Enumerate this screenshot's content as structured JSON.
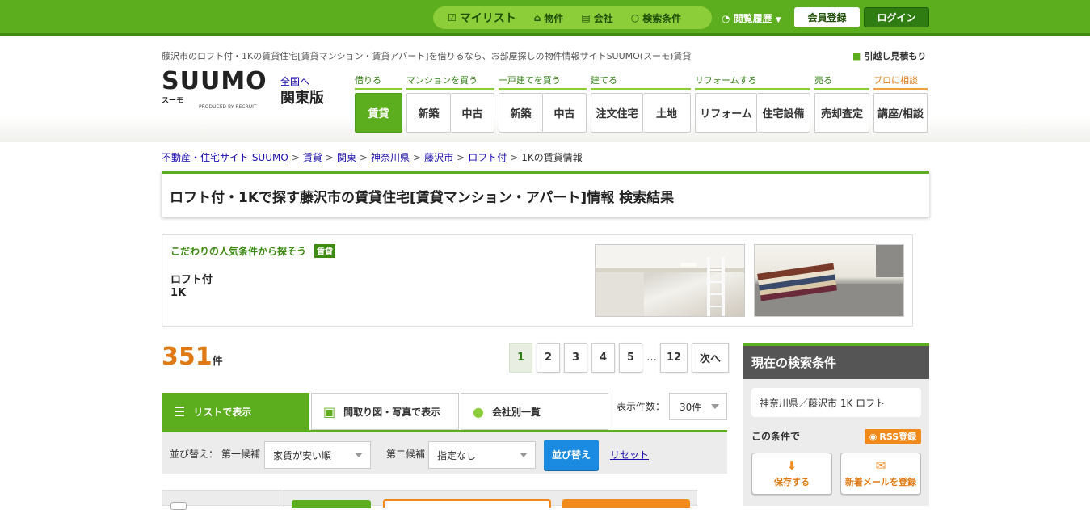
{
  "topbar": {
    "nav": [
      {
        "label": "マイリスト",
        "icon": "mylist-check-icon"
      },
      {
        "label": "物件",
        "icon": "house-icon"
      },
      {
        "label": "会社",
        "icon": "building-icon"
      },
      {
        "label": "検索条件",
        "icon": "search-icon"
      }
    ],
    "history": "閲覧履歴",
    "member_button": "会員登録",
    "login_button": "ログイン"
  },
  "header": {
    "tagline": "藤沢市のロフト付・1Kの賃貸住宅[賃貸マンション・賃貸アパート]を借りるなら、お部屋探しの物件情報サイトSUUMO(スーモ)賃貸",
    "moving_link": "引越し見積もり",
    "logo_text": "SUUMO",
    "logo_sub": "スーモ",
    "logo_produced": "PRODUCED BY RECRUIT",
    "region_link": "全国へ",
    "region_name": "関東版",
    "categories": [
      {
        "label": "借りる",
        "buttons": [
          "賃貸"
        ]
      },
      {
        "label": "マンションを買う",
        "buttons": [
          "新築",
          "中古"
        ]
      },
      {
        "label": "一戸建てを買う",
        "buttons": [
          "新築",
          "中古"
        ]
      },
      {
        "label": "建てる",
        "buttons": [
          "注文住宅",
          "土地"
        ]
      },
      {
        "label": "リフォームする",
        "buttons": [
          "リフォーム",
          "住宅設備"
        ]
      },
      {
        "label": "売る",
        "buttons": [
          "売却査定"
        ]
      },
      {
        "label": "プロに相談",
        "buttons": [
          "講座/相談"
        ]
      }
    ]
  },
  "breadcrumb": [
    "不動産・住宅サイト SUUMO",
    "賃貸",
    "関東",
    "神奈川県",
    "藤沢市",
    "ロフト付",
    "1Kの賃貸情報"
  ],
  "page_title": "ロフト付・1Kで探す藤沢市の賃貸住宅[賃貸マンション・アパート]情報 検索結果",
  "kodawari": {
    "heading": "こだわりの人気条件から探そう",
    "badge": "賃貸",
    "conditions": [
      "ロフト付",
      "1K"
    ]
  },
  "results": {
    "count": "351",
    "unit": "件"
  },
  "pagination": {
    "pages": [
      "1",
      "2",
      "3",
      "4",
      "5"
    ],
    "ellipsis": "…",
    "last": "12",
    "next": "次へ",
    "current": "1"
  },
  "view_tabs": {
    "list": "リストで表示",
    "floorplan": "間取り図・写真で表示",
    "company": "会社別一覧",
    "perpage_label": "表示件数：",
    "perpage_value": "30件"
  },
  "sort": {
    "label": "並び替え：",
    "first_label": "第一候補",
    "first_value": "家賃が安い順",
    "second_label": "第二候補",
    "second_value": "指定なし",
    "button": "並び替え",
    "reset": "リセット"
  },
  "sidebar": {
    "title": "現在の検索条件",
    "condition": "神奈川県／藤沢市 1K ロフト",
    "with_condition": "この条件で",
    "rss": "RSS登録",
    "save": "保存する",
    "mail": "新着メールを登録"
  },
  "colors": {
    "brand_green": "#5cae1e",
    "accent_orange": "#f08a1c",
    "sort_blue": "#1a8be0"
  }
}
